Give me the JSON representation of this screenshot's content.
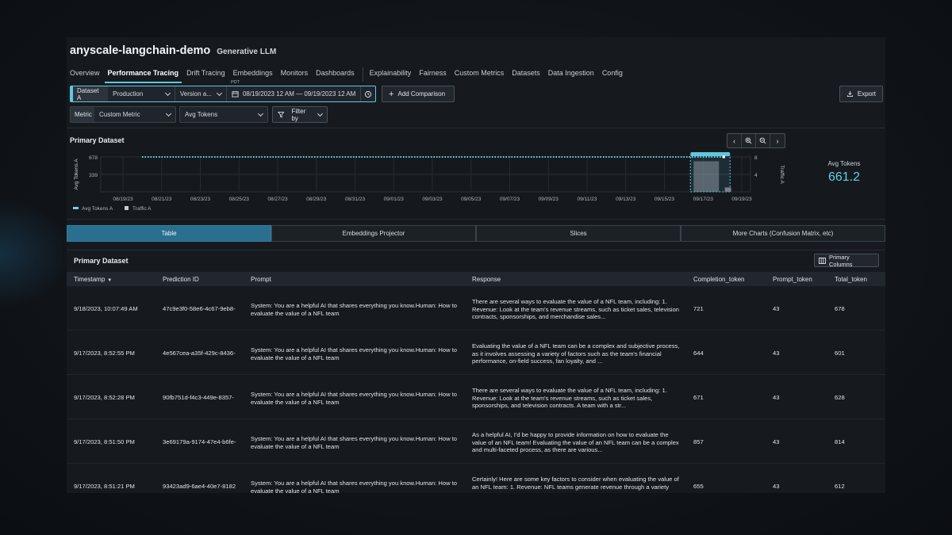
{
  "app": {
    "title": "anyscale-langchain-demo",
    "subtitle": "Generative LLM"
  },
  "tabs": [
    {
      "label": "Overview"
    },
    {
      "label": "Performance Tracing",
      "active": true
    },
    {
      "label": "Drift Tracing"
    },
    {
      "label": "Embeddings"
    },
    {
      "label": "Monitors"
    },
    {
      "label": "Dashboards"
    },
    {
      "label": "Explainability"
    },
    {
      "label": "Fairness"
    },
    {
      "label": "Custom Metrics"
    },
    {
      "label": "Datasets"
    },
    {
      "label": "Data Ingestion"
    },
    {
      "label": "Config"
    }
  ],
  "filters": {
    "dataset_tag": "Dataset A",
    "dataset_value": "Production",
    "version_value": "Version a...",
    "timezone": "PDT",
    "date_range": "08/19/2023 12 AM  —  09/19/2023 12 AM",
    "add_comparison": "Add Comparison",
    "export": "Export",
    "metric_tag": "Metric",
    "metric_type": "Custom Metric",
    "metric_value": "Avg Tokens",
    "filter_by": "Filter by"
  },
  "chart_panel": {
    "title": "Primary Dataset",
    "summary_label": "Avg Tokens",
    "summary_value": "661.2"
  },
  "chart_data": {
    "type": "line",
    "title": "",
    "ylabel": "Avg Tokens A",
    "y2label": "Traffic A",
    "y_ticks": [
      "678",
      "339"
    ],
    "y2_ticks": [
      "8",
      "4"
    ],
    "x_ticks": [
      "08/19/23",
      "08/21/23",
      "08/23/23",
      "08/25/23",
      "08/27/23",
      "08/29/23",
      "08/31/23",
      "09/01/23",
      "09/03/23",
      "09/05/23",
      "09/07/23",
      "09/09/23",
      "09/11/23",
      "09/13/23",
      "09/15/23",
      "09/17/23",
      "09/19/23"
    ],
    "series": [
      {
        "name": "Avg Tokens A",
        "color": "#6fd3e6",
        "style": "dotted",
        "value": 678
      },
      {
        "name": "Traffic A",
        "color": "#8a8f95",
        "type": "bar",
        "values": [
          {
            "x": "09/17/23",
            "value": 7
          },
          {
            "x": "09/18/23",
            "value": 1
          }
        ]
      }
    ],
    "grid": true,
    "legend": "bottom-left"
  },
  "view_tabs": [
    {
      "label": "Table",
      "active": true
    },
    {
      "label": "Embeddings Projector"
    },
    {
      "label": "Slices"
    },
    {
      "label": "More Charts (Confusion Matrix, etc)"
    }
  ],
  "table": {
    "title": "Primary Dataset",
    "columns_button": "Primary Columns",
    "columns": [
      "Timestamp",
      "Prediction ID",
      "Prompt",
      "Response",
      "Completion_token",
      "Prompt_token",
      "Total_token"
    ],
    "sort_indicator": "▼",
    "rows": [
      {
        "timestamp": "9/18/2023, 10:07:49 AM",
        "prediction_id": "47c9e3f0-58e6-4c67-9eb8-",
        "prompt": "System: You are a helpful AI that shares everything you know.Human: How to evaluate the value of a NFL team",
        "response": "There are several ways to evaluate the value of a NFL team, including: 1. Revenue: Look at the team's revenue streams, such as ticket sales, television contracts, sponsorships, and merchandise sales...",
        "completion": "721",
        "prompt_tok": "43",
        "total": "678"
      },
      {
        "timestamp": "9/17/2023, 8:52:55 PM",
        "prediction_id": "4e567cea-a35f-429c-8436-",
        "prompt": "System: You are a helpful AI that shares everything you know.Human: How to evaluate the value of a NFL team",
        "response": "Evaluating the value of a NFL team can be a complex and subjective process, as it involves assessing a variety of factors such as the team's financial performance, on-field success, fan loyalty, and ...",
        "completion": "644",
        "prompt_tok": "43",
        "total": "601"
      },
      {
        "timestamp": "9/17/2023, 8:52:28 PM",
        "prediction_id": "90fb751d-f4c3-449e-8357-",
        "prompt": "System: You are a helpful AI that shares everything you know.Human: How to evaluate the value of a NFL team",
        "response": "There are several ways to evaluate the value of a NFL team, including: 1. Revenue: Look at the team's revenue streams, such as ticket sales, sponsorships, and television contracts. A team with a str...",
        "completion": "671",
        "prompt_tok": "43",
        "total": "628"
      },
      {
        "timestamp": "9/17/2023, 8:51:50 PM",
        "prediction_id": "3e69179a-9174-47e4-b6fe-",
        "prompt": "System: You are a helpful AI that shares everything you know.Human: How to evaluate the value of a NFL team",
        "response": "As a helpful AI, I'd be happy to provide information on how to evaluate the value of an NFL team! Evaluating the value of an NFL team can be a complex and multi-faceted process, as there are various...",
        "completion": "857",
        "prompt_tok": "43",
        "total": "814"
      },
      {
        "timestamp": "9/17/2023, 8:51:21 PM",
        "prediction_id": "93423ad9-6ae4-40e7-8182",
        "prompt": "System: You are a helpful AI that shares everything you know.Human: How to evaluate the value of a NFL team",
        "response": "Certainly! Here are some key factors to consider when evaluating the value of an NFL team: 1. Revenue: NFL teams generate revenue through a variety",
        "completion": "655",
        "prompt_tok": "43",
        "total": "612"
      }
    ]
  },
  "colors": {
    "accent": "#5ec8de",
    "active_tab_bg": "#2a6f8f",
    "panel_bg": "#161a1f"
  }
}
